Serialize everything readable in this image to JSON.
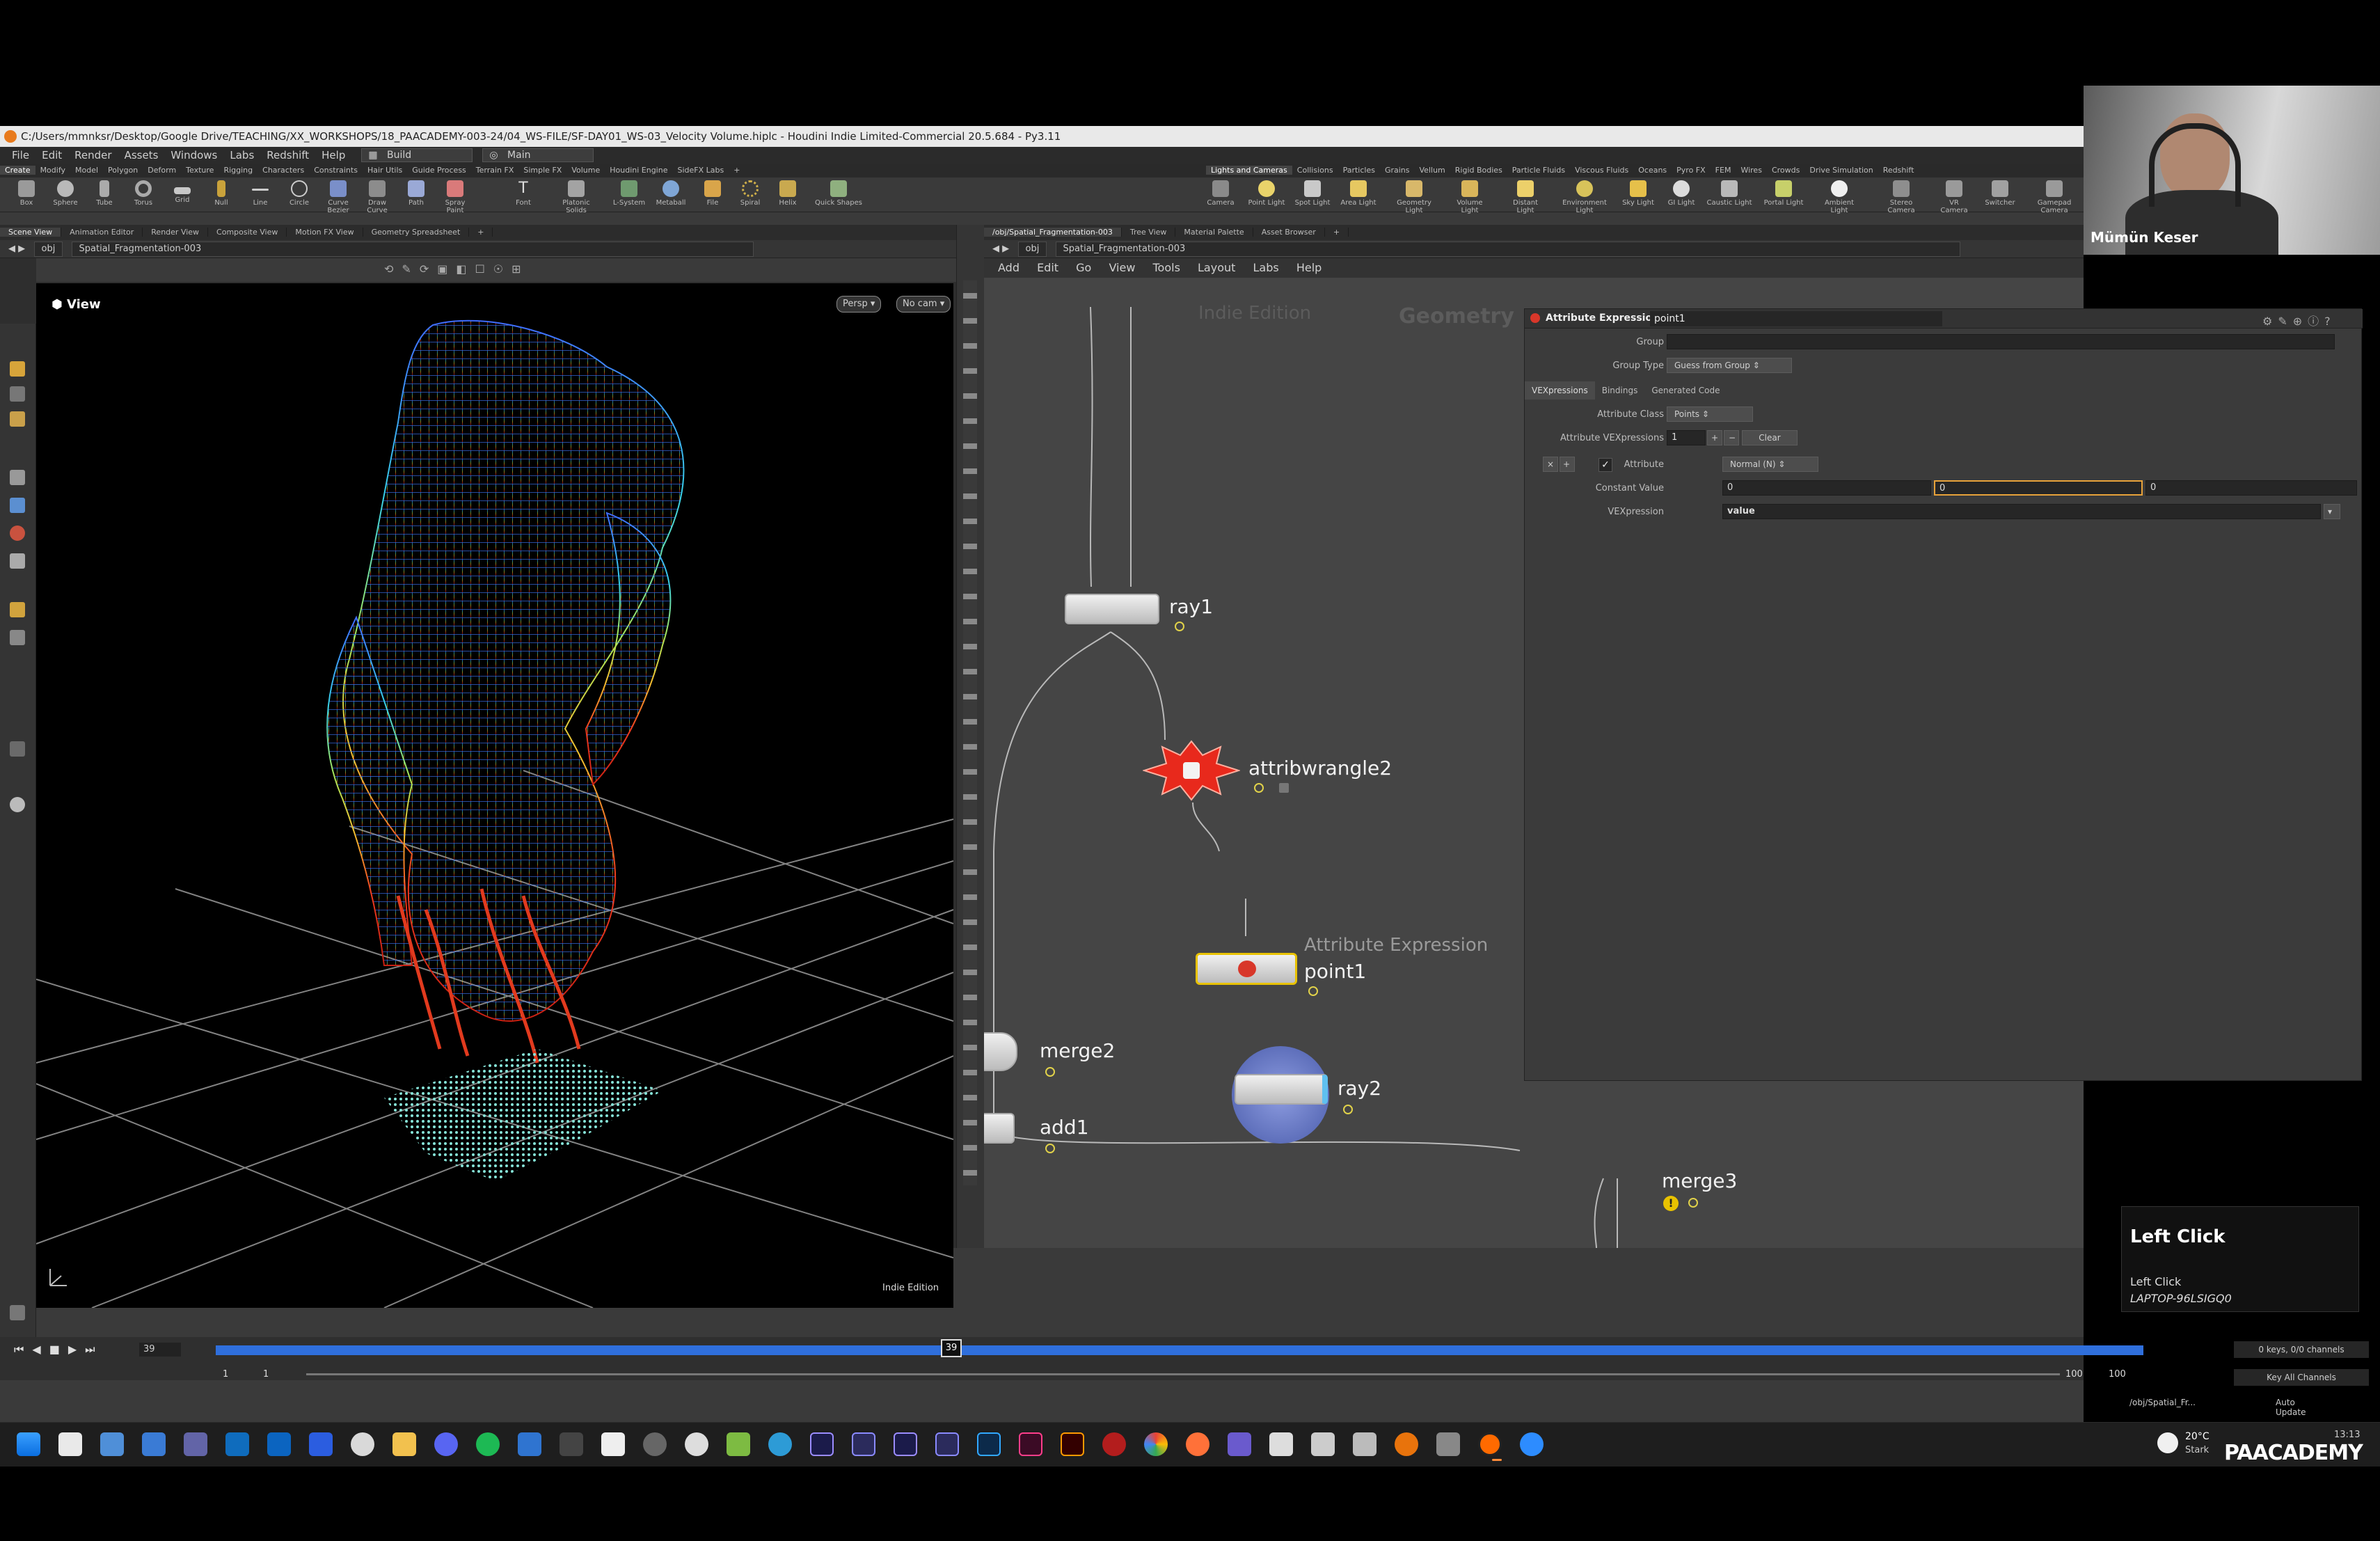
{
  "window": {
    "title": "C:/Users/mmnksr/Desktop/Google Drive/TEACHING/XX_WORKSHOPS/18_PAACADEMY-003-24/04_WS-FILE/SF-DAY01_WS-03_Velocity Volume.hiplc - Houdini Indie Limited-Commercial 20.5.684 - Py3.11"
  },
  "menubar": {
    "items": [
      "File",
      "Edit",
      "Render",
      "Assets",
      "Windows",
      "Labs",
      "Redshift",
      "Help"
    ],
    "desktop_label": "Build",
    "context_label": "Main"
  },
  "shelf_tabs_left": [
    "Create",
    "Modify",
    "Model",
    "Polygon",
    "Deform",
    "Texture",
    "Rigging",
    "Characters",
    "Constraints",
    "Hair Utils",
    "Guide Process",
    "Terrain FX",
    "Simple FX",
    "Volume",
    "Houdini Engine",
    "SideFX Labs"
  ],
  "shelf_tabs_right": [
    "Lights and Cameras",
    "Collisions",
    "Particles",
    "Grains",
    "Vellum",
    "Rigid Bodies",
    "Particle Fluids",
    "Viscous Fluids",
    "Oceans",
    "Pyro FX",
    "FEM",
    "Wires",
    "Crowds",
    "Drive Simulation",
    "Redshift"
  ],
  "shelf_tools_left": [
    "Box",
    "Sphere",
    "Tube",
    "Torus",
    "Grid",
    "Null",
    "Line",
    "Circle",
    "Curve Bezier",
    "Draw Curve",
    "Path",
    "Spray Paint",
    "Font",
    "Platonic Solids",
    "L-System",
    "Metaball",
    "File",
    "Spiral",
    "Helix",
    "Quick Shapes"
  ],
  "shelf_tools_right": [
    "Camera",
    "Point Light",
    "Spot Light",
    "Area Light",
    "Geometry Light",
    "Volume Light",
    "Distant Light",
    "Environment Light",
    "Sky Light",
    "GI Light",
    "Caustic Light",
    "Portal Light",
    "Ambient Light",
    "Stereo Camera",
    "VR Camera",
    "Switcher",
    "Gamepad Camera"
  ],
  "left_pane": {
    "tabs": [
      "Scene View",
      "Animation Editor",
      "Render View",
      "Composite View",
      "Motion FX View",
      "Geometry Spreadsheet"
    ],
    "path_root": "obj",
    "path_node": "Spatial_Fragmentation-003",
    "viewport_label": "View",
    "persp_label": "Persp",
    "cam_label": "No cam",
    "watermark": "Indie Edition"
  },
  "right_pane": {
    "tabs": [
      "/obj/Spatial_Fragmentation-003",
      "Tree View",
      "Material Palette",
      "Asset Browser"
    ],
    "path_root": "obj",
    "path_node": "Spatial_Fragmentation-003",
    "menu": [
      "Add",
      "Edit",
      "Go",
      "View",
      "Tools",
      "Layout",
      "Labs",
      "Help"
    ],
    "watermark": "Indie Edition",
    "context_label": "Geometry"
  },
  "nodes": {
    "ray1": "ray1",
    "attribwrangle2": "attribwrangle2",
    "point1": "point1",
    "point1_type": "Attribute Expression",
    "ray2": "ray2",
    "merge2": "merge2",
    "add1": "add1",
    "merge3": "merge3"
  },
  "params": {
    "node_type": "Attribute Expression",
    "node_name": "point1",
    "group_label": "Group",
    "group_value": "",
    "group_type_label": "Group Type",
    "group_type_value": "Guess from Group",
    "tabs": [
      "VEXpressions",
      "Bindings",
      "Generated Code"
    ],
    "attribute_class_label": "Attribute Class",
    "attribute_class_value": "Points",
    "attr_vexpressions_label": "Attribute VEXpressions",
    "attr_vexpressions_count": "1",
    "clear_label": "Clear",
    "attribute_label": "Attribute",
    "attribute_value": "Normal (N)",
    "constant_value_label": "Constant Value",
    "constant_values": [
      "0",
      "0",
      "0"
    ],
    "vexpression_label": "VEXpression",
    "vexpression_value": "value"
  },
  "timeline": {
    "current_frame": "39",
    "start_frame": "1",
    "range_start": "1",
    "range_end": "100",
    "end_frame": "100",
    "keys_label": "0 keys, 0/0 channels",
    "key_all_label": "Key All Channels",
    "path_label": "/obj/Spatial_Fr...",
    "auto_update_label": "Auto Update"
  },
  "webcam": {
    "name": "Mümün Keser"
  },
  "hint": {
    "title": "Left Click",
    "line1": "Left Click",
    "line2": "LAPTOP-96LSIGQ0"
  },
  "taskbar": {
    "weather": "20°C",
    "weather_desc": "Stark",
    "clock": "13:13",
    "brand": "PAACADEMY"
  },
  "colors": {
    "node_error": "#e8291c",
    "node_selected": "#e8c200",
    "ray2_display": "#5a6fb0",
    "timeline_blue": "#2f6fdc"
  }
}
